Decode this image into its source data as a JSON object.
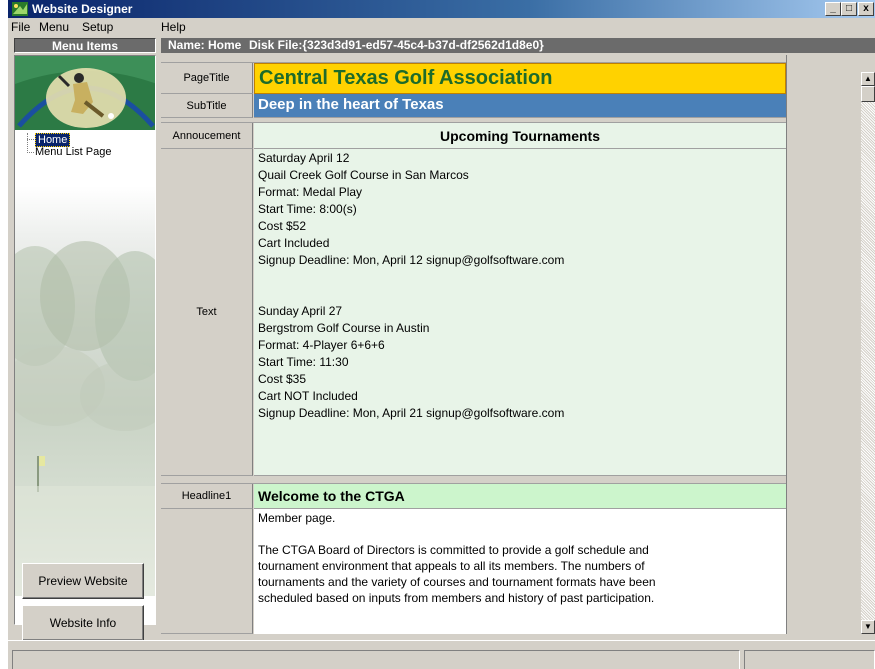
{
  "window": {
    "title": "Website Designer",
    "controls": {
      "minimize": "_",
      "maximize": "□",
      "close": "x"
    }
  },
  "menu": {
    "file": "File",
    "menu": "Menu",
    "setup": "Setup",
    "help": "Help"
  },
  "left": {
    "header": "Menu Items",
    "tree": [
      {
        "label": "Home",
        "selected": true
      },
      {
        "label": "Menu List Page",
        "selected": false
      }
    ],
    "preview_button": "Preview Website",
    "info_button": "Website Info"
  },
  "page": {
    "name_label": "Name: Home",
    "disk_file": "Disk File:{323d3d91-ed57-45c4-b37d-df2562d1d8e0}"
  },
  "fields": {
    "pagetitle": {
      "label": "PageTitle",
      "value": "Central Texas Golf Association"
    },
    "subtitle": {
      "label": "SubTitle",
      "value": "Deep in the heart of Texas"
    },
    "announcement": {
      "label": "Annoucement",
      "value": "Upcoming Tournaments"
    },
    "text": {
      "label": "Text",
      "lines": [
        "Saturday April 12",
        "Quail Creek Golf Course in San Marcos",
        "Format: Medal Play",
        "Start Time: 8:00(s)",
        "Cost $52",
        "Cart Included",
        "Signup Deadline: Mon, April 12 signup@golfsoftware.com",
        "",
        "",
        "Sunday April 27",
        "Bergstrom Golf Course in Austin",
        "Format: 4-Player 6+6+6",
        "Start Time: 11:30",
        "Cost $35",
        "Cart NOT Included",
        "Signup Deadline: Mon, April 21 signup@golfsoftware.com"
      ]
    },
    "headline1": {
      "label": "Headline1",
      "value": "Welcome to the CTGA"
    },
    "member": {
      "lines": [
        "Member page.",
        "",
        "The CTGA Board of Directors is committed to provide a golf schedule and",
        "tournament environment that appeals to all its members. The numbers of",
        "tournaments and the variety of courses and tournament formats have been",
        "scheduled based on inputs from members and history of past participation."
      ]
    }
  },
  "colors": {
    "pagetitle_bg": "#ffd200",
    "pagetitle_fg": "#1d6b2a",
    "subtitle_bg": "#4a80b8",
    "announce_bg": "#e8f4e8",
    "headline_bg": "#ccf5cc"
  },
  "icons": {
    "app": "website-designer-icon",
    "scroll_up": "scroll-up-arrow-icon",
    "scroll_down": "scroll-down-arrow-icon"
  }
}
